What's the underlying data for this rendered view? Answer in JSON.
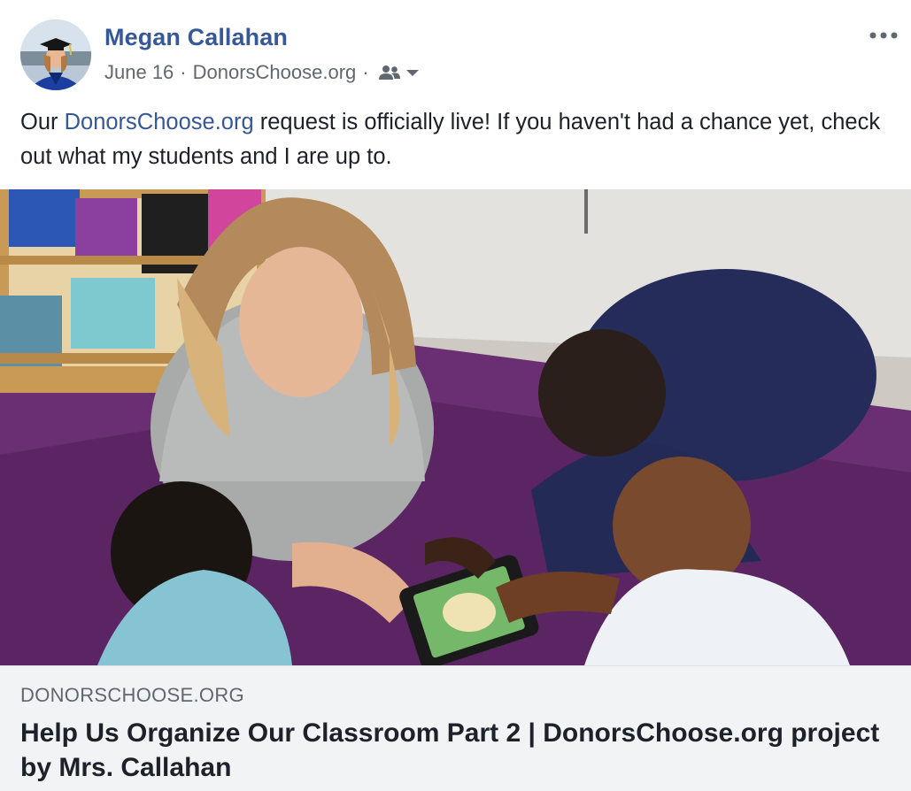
{
  "post": {
    "author": "Megan Callahan",
    "date": "June 16",
    "source": "DonorsChoose.org",
    "audience_icon": "friends-icon",
    "message_prefix": "Our ",
    "message_link": "DonorsChoose.org",
    "message_suffix": " request is officially live! If you haven't had a chance yet, check out what my students and I are up to."
  },
  "link_card": {
    "domain": "DONORSCHOOSE.ORG",
    "title": "Help Us Organize Our Classroom Part 2 | DonorsChoose.org project by Mrs. Callahan"
  },
  "colors": {
    "author_link": "#365899",
    "meta_text": "#616770",
    "card_bg": "#f2f3f5"
  }
}
